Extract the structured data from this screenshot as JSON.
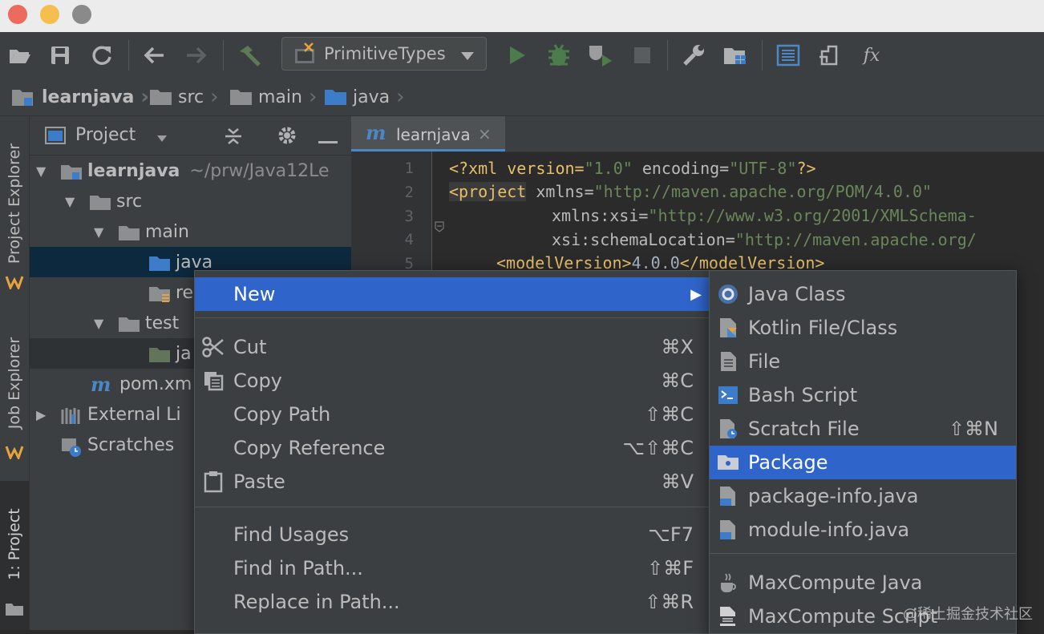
{
  "colors": {
    "traffic_red": "#ed6a5e",
    "traffic_yellow": "#f4bf4f",
    "traffic_gray": "#8a8a8a",
    "highlight": "#2f65ca",
    "run_green": "#499c54"
  },
  "toolbar": {
    "run_config": "PrimitiveTypes",
    "icons": [
      "open-folder-icon",
      "save-icon",
      "sync-icon",
      "back-arrow-icon",
      "forward-arrow-icon",
      "build-hammer-icon",
      "run-icon",
      "debug-icon",
      "coverage-icon",
      "stop-icon",
      "wrench-icon",
      "project-structure-icon",
      "sdk-icon",
      "pack-icon",
      "fx-icon"
    ],
    "fx_label": "fx"
  },
  "breadcrumb": [
    "learnjava",
    "src",
    "main",
    "java"
  ],
  "left_strip": {
    "tabs": [
      "Project Explorer",
      "Job Explorer",
      "1: Project"
    ]
  },
  "project_panel": {
    "title": "Project",
    "tree": [
      {
        "label": "learnjava",
        "path": "~/prw/Java12Le"
      },
      {
        "label": "src"
      },
      {
        "label": "main"
      },
      {
        "label": "java"
      },
      {
        "label": "re"
      },
      {
        "label": "test"
      },
      {
        "label": "ja"
      },
      {
        "label": "pom.xm"
      },
      {
        "label": "External Li"
      },
      {
        "label": "Scratches"
      }
    ]
  },
  "editor": {
    "tab": {
      "label": "learnjava",
      "close": "×"
    },
    "line_numbers": [
      "1",
      "2",
      "3",
      "4",
      "5"
    ],
    "lines": [
      {
        "a": "<?xml version=",
        "b": "\"1.0\"",
        "c": " encoding=",
        "d": "\"UTF-8\"",
        "e": "?>"
      },
      {
        "a": "<project",
        "b": " xmlns=",
        "c": "\"http://maven.apache.org/POM/4.0.0\""
      },
      {
        "a": "xmlns:xsi=",
        "b": "\"http://www.w3.org/2001/XMLSchema-"
      },
      {
        "a": "xsi:schemaLocation=",
        "b": "\"http://maven.apache.org/"
      },
      {
        "a": "<modelVersion>",
        "b": "4.0.0",
        "c": "</modelVersion>"
      }
    ]
  },
  "context_menu": {
    "items": [
      {
        "label": "New",
        "shortcut": "",
        "submenu": true
      },
      {
        "label": "Cut",
        "shortcut": "⌘X"
      },
      {
        "label": "Copy",
        "shortcut": "⌘C"
      },
      {
        "label": "Copy Path",
        "shortcut": "⇧⌘C"
      },
      {
        "label": "Copy Reference",
        "shortcut": "⌥⇧⌘C"
      },
      {
        "label": "Paste",
        "shortcut": "⌘V"
      },
      {
        "label": "Find Usages",
        "shortcut": "⌥F7"
      },
      {
        "label": "Find in Path...",
        "shortcut": "⇧⌘F"
      },
      {
        "label": "Replace in Path...",
        "shortcut": "⇧⌘R"
      }
    ],
    "submenu_arrow": "▶"
  },
  "new_submenu": {
    "items": [
      {
        "label": "Java Class",
        "shortcut": ""
      },
      {
        "label": "Kotlin File/Class",
        "shortcut": ""
      },
      {
        "label": "File",
        "shortcut": ""
      },
      {
        "label": "Bash Script",
        "shortcut": ""
      },
      {
        "label": "Scratch File",
        "shortcut": "⇧⌘N"
      },
      {
        "label": "Package",
        "shortcut": ""
      },
      {
        "label": "package-info.java",
        "shortcut": ""
      },
      {
        "label": "module-info.java",
        "shortcut": ""
      },
      {
        "label": "MaxCompute Java",
        "shortcut": ""
      },
      {
        "label": "MaxCompute Script",
        "shortcut": ""
      }
    ]
  },
  "watermark": "@稀土掘金技术社区"
}
